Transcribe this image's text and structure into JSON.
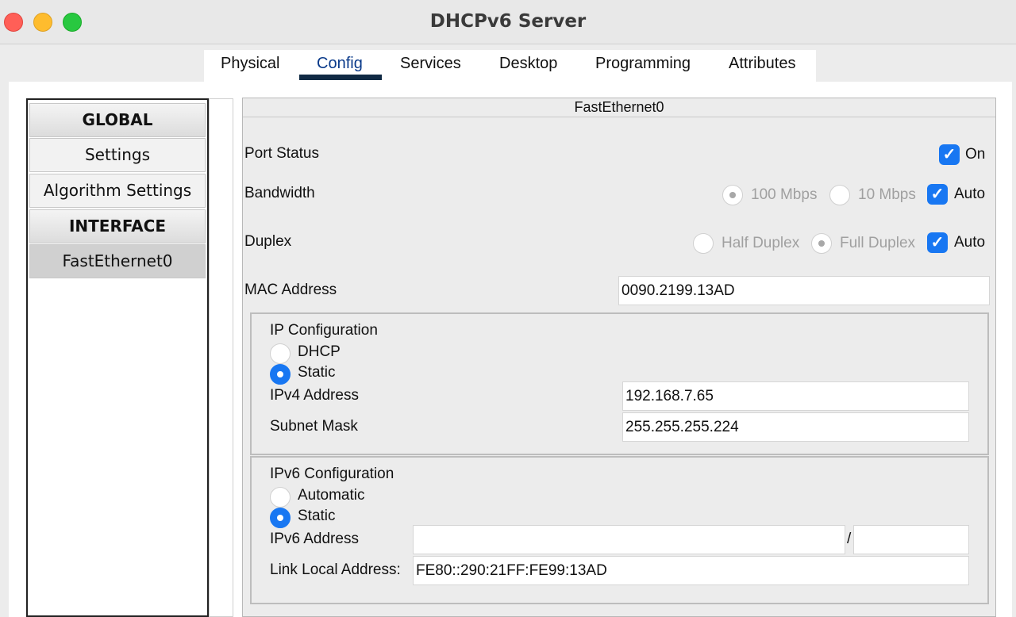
{
  "window": {
    "title": "DHCPv6 Server"
  },
  "tabs": [
    {
      "label": "Physical"
    },
    {
      "label": "Config"
    },
    {
      "label": "Services"
    },
    {
      "label": "Desktop"
    },
    {
      "label": "Programming"
    },
    {
      "label": "Attributes"
    }
  ],
  "sidebar": {
    "global_header": "GLOBAL",
    "settings": "Settings",
    "algorithm_settings": "Algorithm Settings",
    "interface_header": "INTERFACE",
    "fastethernet": "FastEthernet0"
  },
  "interface": {
    "title": "FastEthernet0",
    "port_status": {
      "label": "Port Status",
      "on_label": "On",
      "checked": true
    },
    "bandwidth": {
      "label": "Bandwidth",
      "opt_100": "100 Mbps",
      "opt_10": "10 Mbps",
      "auto_label": "Auto",
      "auto_checked": true
    },
    "duplex": {
      "label": "Duplex",
      "opt_half": "Half Duplex",
      "opt_full": "Full Duplex",
      "auto_label": "Auto",
      "auto_checked": true
    },
    "mac": {
      "label": "MAC Address",
      "value": "0090.2199.13AD"
    },
    "ip_config": {
      "title": "IP Configuration",
      "dhcp_label": "DHCP",
      "static_label": "Static",
      "ipv4_label": "IPv4 Address",
      "ipv4_value": "192.168.7.65",
      "subnet_label": "Subnet Mask",
      "subnet_value": "255.255.255.224"
    },
    "ipv6_config": {
      "title": "IPv6 Configuration",
      "automatic_label": "Automatic",
      "static_label": "Static",
      "ipv6_label": "IPv6 Address",
      "ipv6_value": "",
      "prefix_sep": "/",
      "prefix_value": "",
      "link_local_label": "Link Local Address:",
      "link_local_value": "FE80::290:21FF:FE99:13AD"
    }
  },
  "colors": {
    "accent": "#1877f2",
    "tab_underline": "#102a44"
  }
}
